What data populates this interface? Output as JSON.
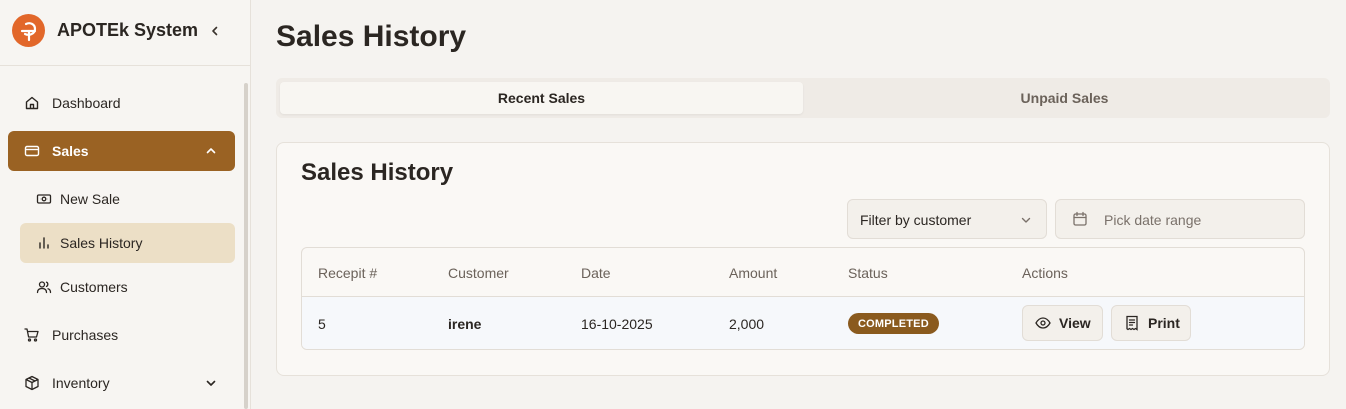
{
  "brand": {
    "title": "APOTEk System"
  },
  "sidebar": {
    "items": [
      {
        "label": "Dashboard",
        "icon": "home-icon"
      },
      {
        "label": "Sales",
        "icon": "credit-card-icon",
        "expanded": true,
        "active": true
      },
      {
        "label": "New Sale",
        "icon": "banknote-icon"
      },
      {
        "label": "Sales History",
        "icon": "bar-chart-icon",
        "active": true
      },
      {
        "label": "Customers",
        "icon": "users-icon"
      },
      {
        "label": "Purchases",
        "icon": "cart-icon"
      },
      {
        "label": "Inventory",
        "icon": "package-icon"
      }
    ]
  },
  "page": {
    "title": "Sales History"
  },
  "tabs": [
    {
      "label": "Recent Sales",
      "active": true
    },
    {
      "label": "Unpaid Sales",
      "active": false
    }
  ],
  "card": {
    "title": "Sales History",
    "filter_label": "Filter by customer",
    "date_placeholder": "Pick date range"
  },
  "table": {
    "columns": [
      "Recepit #",
      "Customer",
      "Date",
      "Amount",
      "Status",
      "Actions"
    ],
    "rows": [
      {
        "receipt": "5",
        "customer": "irene",
        "date": "16-10-2025",
        "amount": "2,000",
        "status": "COMPLETED"
      }
    ],
    "actions": {
      "view": "View",
      "print": "Print"
    }
  },
  "colors": {
    "accent": "#9a6223",
    "accent_light": "#ecdfc6",
    "badge": "#8a5a1e",
    "logo": "#e2672a"
  }
}
